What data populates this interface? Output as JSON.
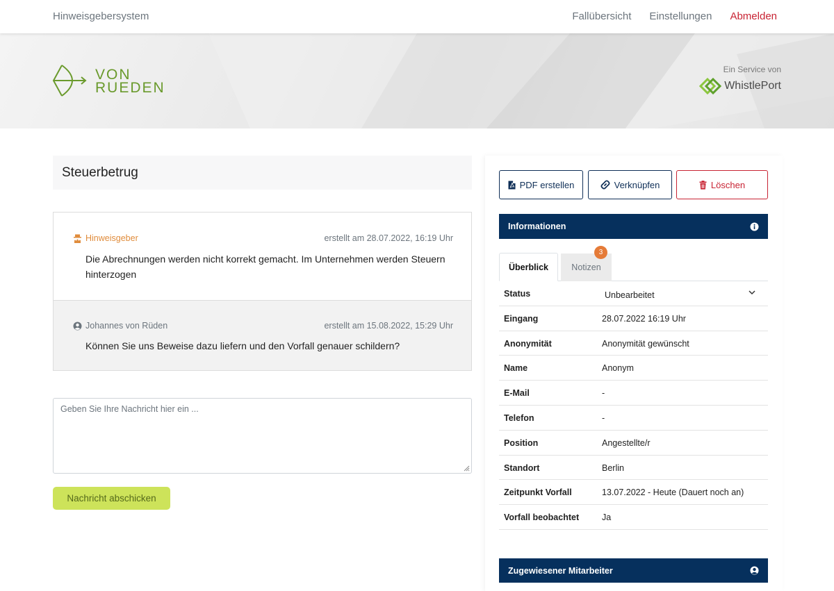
{
  "nav": {
    "brand": "Hinweisgebersystem",
    "links": [
      "Fallübersicht",
      "Einstellungen",
      "Abmelden"
    ]
  },
  "banner": {
    "logo_line1": "VON",
    "logo_line2": "RUEDEN",
    "service_label": "Ein Service von",
    "service_name": "WhistlePort"
  },
  "case": {
    "title": "Steuerbetrug"
  },
  "messages": [
    {
      "author": "Hinweisgeber",
      "created": "erstellt am 28.07.2022, 16:19 Uhr",
      "text": "Die Abrechnungen werden nicht korrekt gemacht. Im Unternehmen werden Steuern hinterzogen"
    },
    {
      "author": "Johannes von Rüden",
      "created": "erstellt am 15.08.2022, 15:29 Uhr",
      "text": "Können Sie uns Beweise dazu liefern und den Vorfall genauer schildern?"
    }
  ],
  "compose": {
    "placeholder": "Geben Sie Ihre Nachricht hier ein ...",
    "value": "",
    "send_label": "Nachricht abschicken"
  },
  "actions": {
    "pdf": "PDF erstellen",
    "link": "Verknüpfen",
    "delete": "Löschen"
  },
  "info": {
    "header": "Informationen",
    "tabs": [
      {
        "label": "Überblick",
        "active": true
      },
      {
        "label": "Notizen",
        "active": false,
        "badge": "3"
      }
    ],
    "rows": [
      {
        "label": "Status",
        "value": "Unbearbeitet"
      },
      {
        "label": "Eingang",
        "value": "28.07.2022 16:19 Uhr"
      },
      {
        "label": "Anonymität",
        "value": "Anonymität gewünscht"
      },
      {
        "label": "Name",
        "value": "Anonym"
      },
      {
        "label": "E-Mail",
        "value": "-"
      },
      {
        "label": "Telefon",
        "value": "-"
      },
      {
        "label": "Position",
        "value": "Angestellte/r"
      },
      {
        "label": "Standort",
        "value": "Berlin"
      },
      {
        "label": "Zeitpunkt Vorfall",
        "value": "13.07.2022 - Heute (Dauert noch an)"
      },
      {
        "label": "Vorfall beobachtet",
        "value": "Ja"
      }
    ]
  },
  "assigned": {
    "header": "Zugewiesener Mitarbeiter"
  },
  "colors": {
    "navy": "#06305d",
    "accent_green": "#cde35a",
    "danger": "#c82333",
    "whistleblower_orange": "#e08c3c",
    "badge_orange": "#e57b38"
  }
}
